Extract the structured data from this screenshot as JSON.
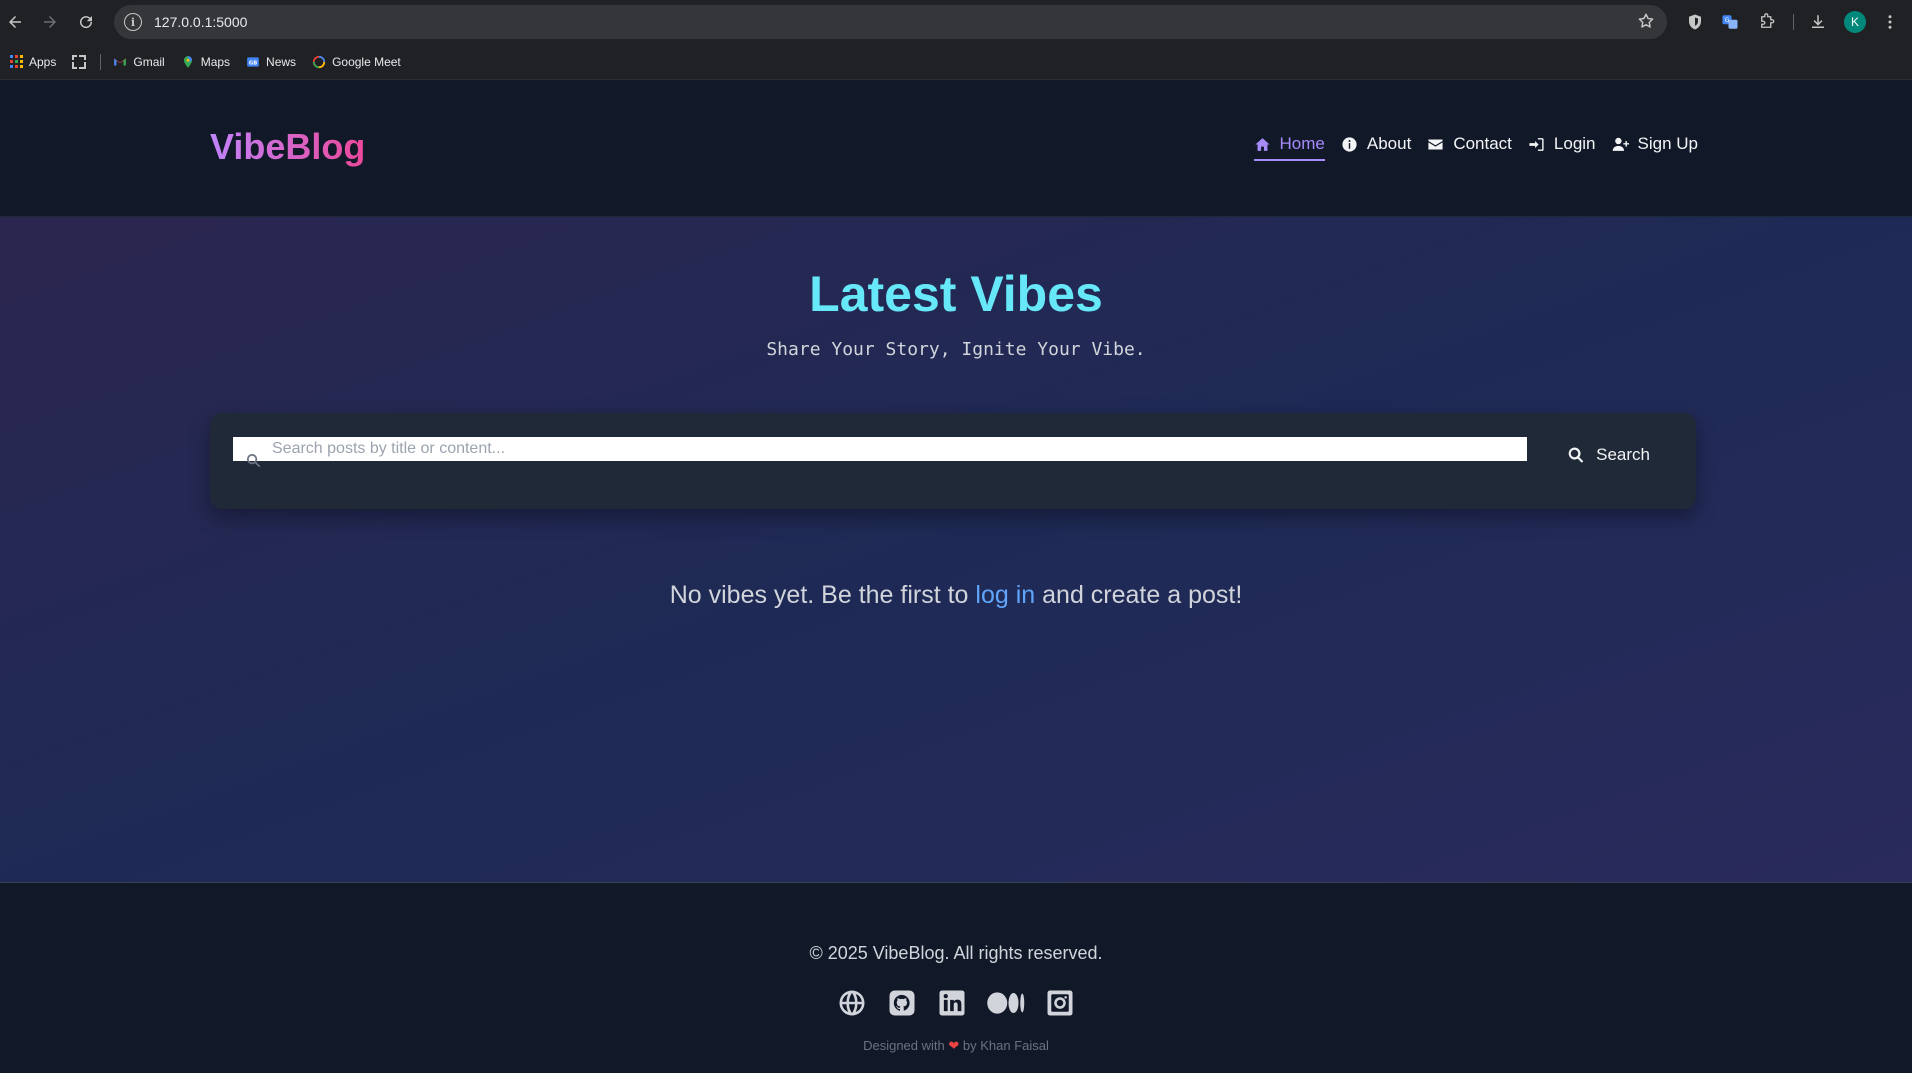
{
  "browser": {
    "url": "127.0.0.1:5000",
    "avatar_letter": "K",
    "bookmarks": [
      {
        "label": "Apps"
      },
      {
        "label": "Gmail"
      },
      {
        "label": "Maps"
      },
      {
        "label": "News"
      },
      {
        "label": "Google Meet"
      }
    ]
  },
  "site": {
    "logo": "VibeBlog",
    "nav": [
      {
        "label": "Home",
        "icon": "home-icon",
        "active": true
      },
      {
        "label": "About",
        "icon": "info-icon"
      },
      {
        "label": "Contact",
        "icon": "envelope-icon"
      },
      {
        "label": "Login",
        "icon": "sign-in-icon"
      },
      {
        "label": "Sign Up",
        "icon": "user-plus-icon"
      }
    ]
  },
  "hero": {
    "title": "Latest Vibes",
    "subtitle": "Share Your Story, Ignite Your Vibe."
  },
  "search": {
    "placeholder": "Search posts by title or content...",
    "value": "",
    "button_label": "Search"
  },
  "empty_state": {
    "before": "No vibes yet. Be the first to ",
    "link": "log in",
    "after": " and create a post!"
  },
  "footer": {
    "copyright": "© 2025 VibeBlog. All rights reserved.",
    "socials": [
      "globe-icon",
      "github-icon",
      "linkedin-icon",
      "medium-icon",
      "instagram-icon"
    ],
    "credit_before": "Designed with ",
    "credit_heart": "❤",
    "credit_after": " by Khan Faisal"
  },
  "colors": {
    "accent": "#a78bfa",
    "title": "#67e8f9",
    "link": "#60a5fa"
  }
}
